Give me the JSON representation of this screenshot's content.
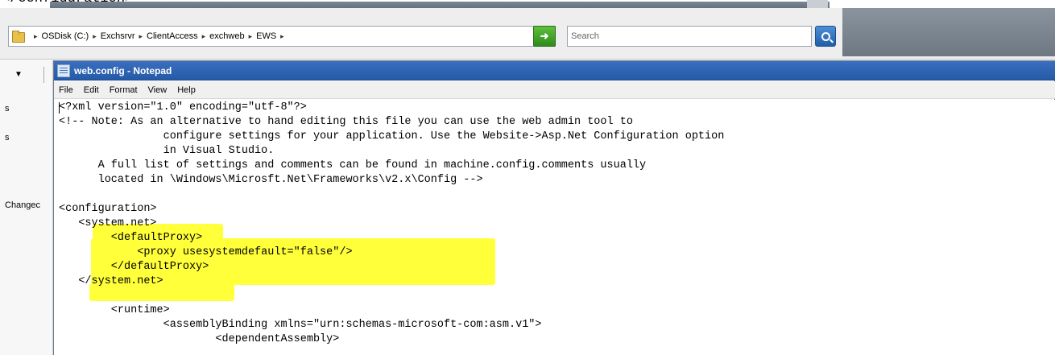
{
  "background": {
    "partial_text": "</configuration>"
  },
  "explorer": {
    "breadcrumb": [
      "OSDisk (C:)",
      "Exchsrvr",
      "ClientAccess",
      "exchweb",
      "EWS"
    ],
    "separator": "▸",
    "search_placeholder": "Search"
  },
  "left_pane": {
    "labels": [
      "s",
      "s",
      "Changec"
    ]
  },
  "notepad": {
    "title": "web.config - Notepad",
    "menu": [
      "File",
      "Edit",
      "Format",
      "View",
      "Help"
    ],
    "lines": [
      "<?xml version=\"1.0\" encoding=\"utf-8\"?>",
      "<!-- Note: As an alternative to hand editing this file you can use the web admin tool to",
      "                configure settings for your application. Use the Website->Asp.Net Configuration option",
      "                in Visual Studio.",
      "      A full list of settings and comments can be found in machine.config.comments usually",
      "      located in \\Windows\\Microsft.Net\\Frameworks\\v2.x\\Config -->",
      "",
      "<configuration>",
      "   <system.net>",
      "        <defaultProxy>",
      "            <proxy usesystemdefault=\"false\"/>",
      "        </defaultProxy>",
      "   </system.net>",
      "",
      "        <runtime>",
      "                <assemblyBinding xmlns=\"urn:schemas-microsoft-com:asm.v1\">",
      "                        <dependentAssembly>"
    ]
  },
  "colors": {
    "highlight": "#ffff3a",
    "titlebar": "#245aa6"
  }
}
